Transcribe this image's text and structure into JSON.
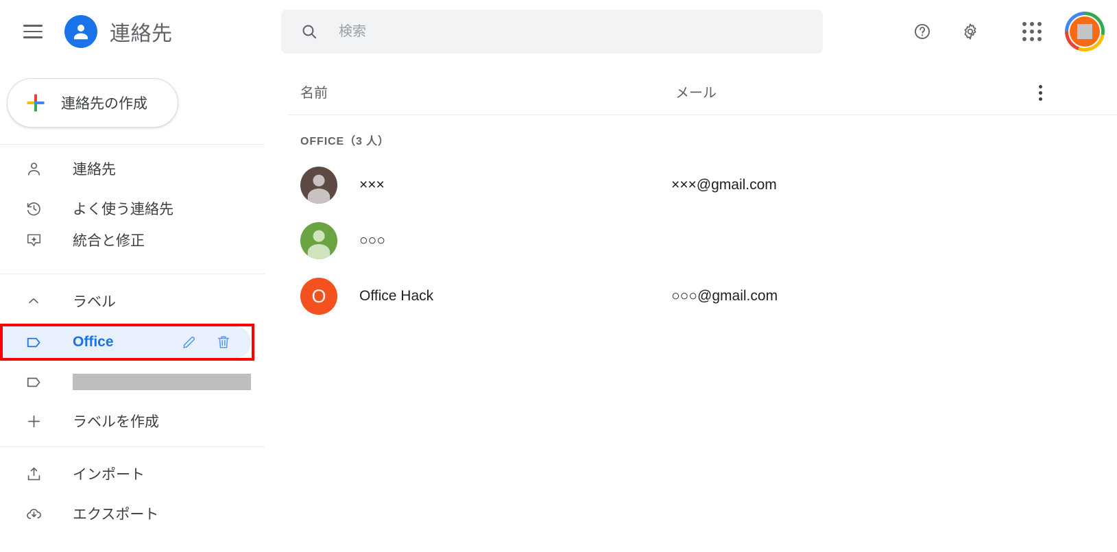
{
  "app": {
    "title": "連絡先",
    "brand_icon": "person-circle-icon",
    "menu_icon": "hamburger-menu-icon",
    "accent_blue": "#1a73e8",
    "highlight_bg": "#e8f0fe",
    "annotation_red": "#ff0000"
  },
  "sidebar": {
    "create_button": {
      "label": "連絡先の作成",
      "icon": "plus-multicolor-icon"
    },
    "nav": [
      {
        "label": "連絡先",
        "icon": "person-icon"
      },
      {
        "label": "よく使う連絡先",
        "icon": "history-clock-icon"
      },
      {
        "label": "統合と修正",
        "icon": "merge-fix-icon"
      }
    ],
    "labels_section": {
      "header": {
        "label": "ラベル",
        "icon": "chevron-up-icon"
      },
      "items": [
        {
          "label": "Office",
          "icon": "label-tag-icon",
          "selected": true,
          "annotated": true,
          "edit_icon": "pencil-icon",
          "delete_icon": "trash-icon"
        },
        {
          "label": "",
          "icon": "label-tag-icon",
          "selected": false,
          "redacted": true
        }
      ],
      "create_label": {
        "label": "ラベルを作成",
        "icon": "plus-icon"
      }
    },
    "footer": [
      {
        "label": "インポート",
        "icon": "upload-icon"
      },
      {
        "label": "エクスポート",
        "icon": "cloud-download-icon"
      }
    ]
  },
  "topbar": {
    "search": {
      "placeholder": "検索",
      "value": "",
      "icon": "search-icon"
    },
    "help_icon": "help-circle-icon",
    "settings_icon": "gear-icon",
    "apps_icon": "apps-grid-icon",
    "account_avatar": {
      "icon": "account-avatar",
      "color": "#f96a14",
      "redacted": true
    }
  },
  "main": {
    "columns": {
      "name": "名前",
      "email": "メール"
    },
    "more_options_icon": "more-vertical-icon",
    "group": {
      "label": "OFFICE（3 人）"
    },
    "contacts": [
      {
        "name": "×××",
        "email": "×××@gmail.com",
        "avatar": {
          "type": "silhouette",
          "color": "#5d4a42",
          "fg": "#c8c3c0",
          "letter": ""
        }
      },
      {
        "name": "○○○",
        "email": "",
        "avatar": {
          "type": "silhouette",
          "color": "#6aa341",
          "fg": "#cfe3bc",
          "letter": ""
        }
      },
      {
        "name": "Office Hack",
        "email": "○○○@gmail.com",
        "avatar": {
          "type": "letter",
          "color": "#f4511e",
          "fg": "#ffffff",
          "letter": "O"
        }
      }
    ]
  }
}
